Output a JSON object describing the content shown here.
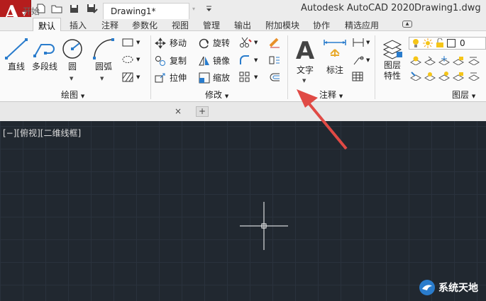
{
  "app": {
    "letter": "A",
    "title": "Autodesk AutoCAD 2020",
    "document": "Drawing1.dwg"
  },
  "qat": {
    "icons": [
      "new-file-icon",
      "open-folder-icon",
      "save-icon",
      "save-as-icon",
      "web-mobile-icon",
      "import-icon",
      "print-icon",
      "undo-icon",
      "redo-icon",
      "customize-icon"
    ]
  },
  "tabs": [
    "默认",
    "插入",
    "注释",
    "参数化",
    "视图",
    "管理",
    "输出",
    "附加模块",
    "协作",
    "精选应用"
  ],
  "draw_panel": {
    "title": "绘图",
    "line": "直线",
    "polyline": "多段线",
    "circle": "圆",
    "arc": "圆弧"
  },
  "modify_panel": {
    "title": "修改",
    "move": "移动",
    "rotate": "旋转",
    "copy": "复制",
    "mirror": "镜像",
    "stretch": "拉伸",
    "scale": "缩放"
  },
  "annotation_panel": {
    "title": "注释",
    "text": "文字",
    "dimension": "标注"
  },
  "layer_panel": {
    "title": "图层",
    "properties_l1": "图层",
    "properties_l2": "特性",
    "current_layer": "0"
  },
  "doc_tabs": {
    "start": "开始",
    "drawing": "Drawing1*",
    "close": "×",
    "add": "+"
  },
  "viewport": {
    "label": "[−][俯视][二维线框]"
  },
  "watermark": {
    "text": "系统天地"
  },
  "colors": {
    "app_red": "#b51d1d",
    "canvas": "#212830",
    "arrow": "#e04a45",
    "lightbulb": "#f5c518"
  }
}
